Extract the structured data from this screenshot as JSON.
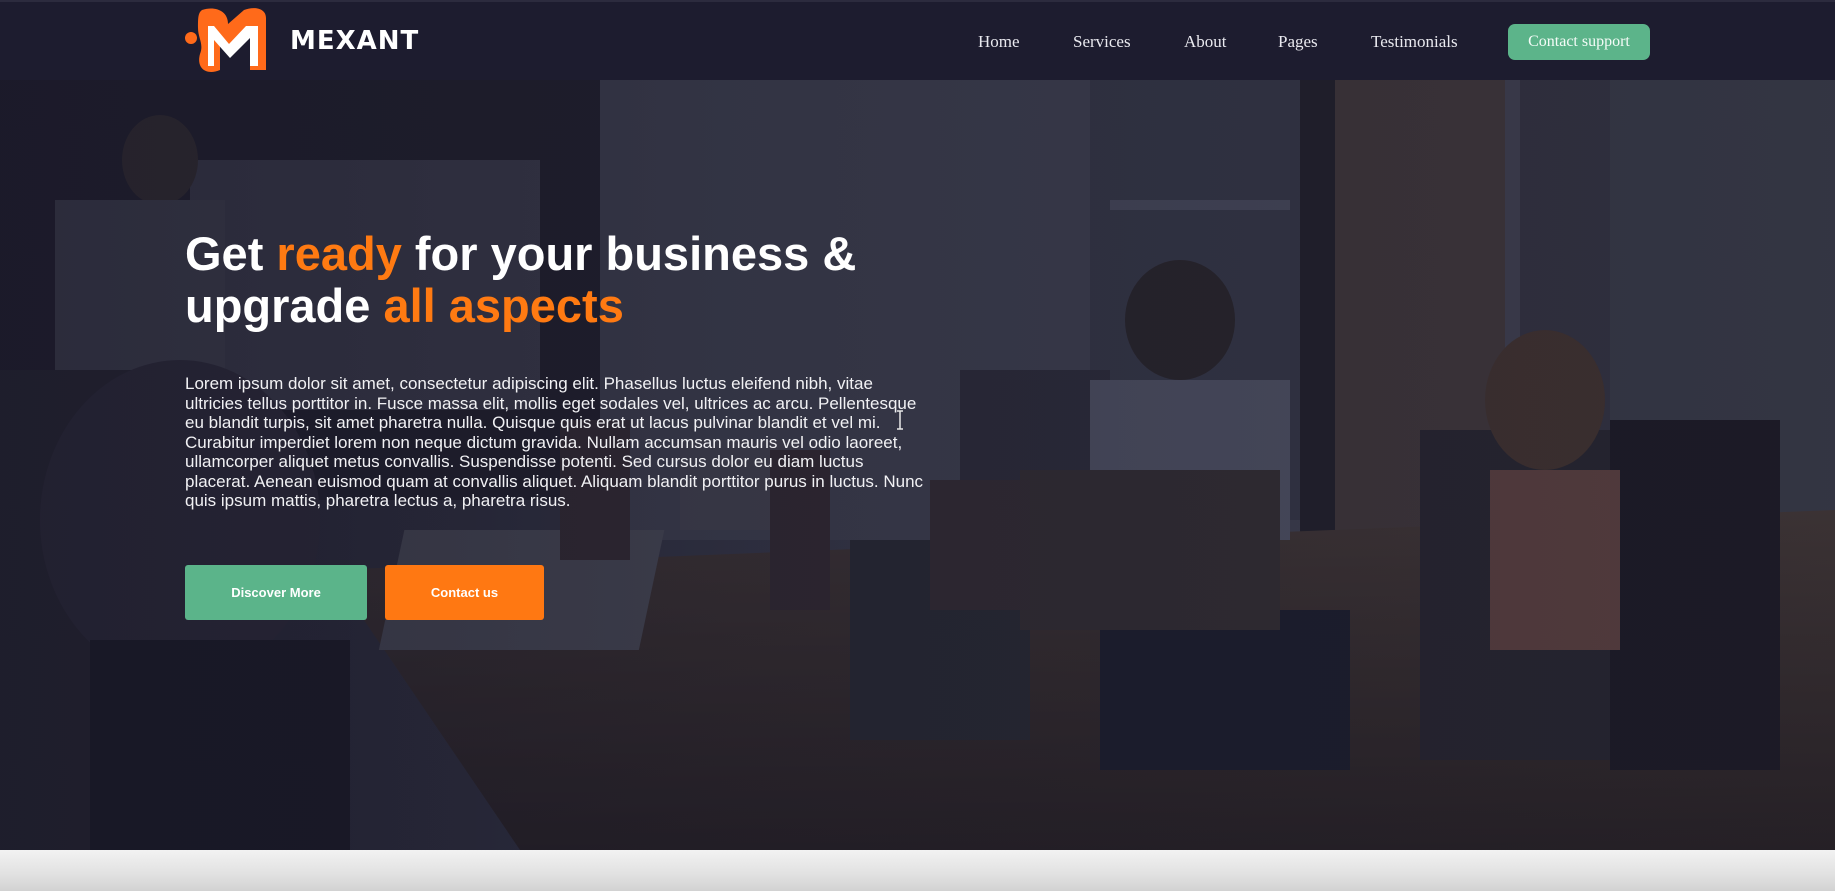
{
  "header": {
    "logo_text": "MEXANT",
    "logo_icon": "mexant-m-logo",
    "nav": [
      {
        "label": "Home"
      },
      {
        "label": "Services"
      },
      {
        "label": "About"
      },
      {
        "label": "Pages"
      },
      {
        "label": "Testimonials"
      }
    ],
    "cta_label": "Contact support"
  },
  "hero": {
    "title_part1": "Get ",
    "title_accent1": "ready",
    "title_part2": " for your business &",
    "title_part3": "upgrade ",
    "title_accent2": "all aspects",
    "description": "Lorem ipsum dolor sit amet, consectetur adipiscing elit. Phasellus luctus eleifend nibh, vitae ultricies tellus porttitor in. Fusce massa elit, mollis eget sodales vel, ultrices ac arcu. Pellentesque eu blandit turpis, sit amet pharetra nulla. Quisque quis erat ut lacus pulvinar blandit et vel mi. Curabitur imperdiet lorem non neque dictum gravida. Nullam accumsan mauris vel odio laoreet, ullamcorper aliquet metus convallis. Suspendisse potenti. Sed cursus dolor eu diam luctus placerat. Aenean euismod quam at convallis aliquet. Aliquam blandit porttitor purus in luctus. Nunc quis ipsum mattis, pharetra lectus a, pharetra risus.",
    "primary_button": "Discover More",
    "secondary_button": "Contact us"
  },
  "colors": {
    "header_bg": "#1d1c2f",
    "accent_orange": "#ff7a12",
    "accent_green": "#5bb48a",
    "text_white": "#ffffff"
  }
}
